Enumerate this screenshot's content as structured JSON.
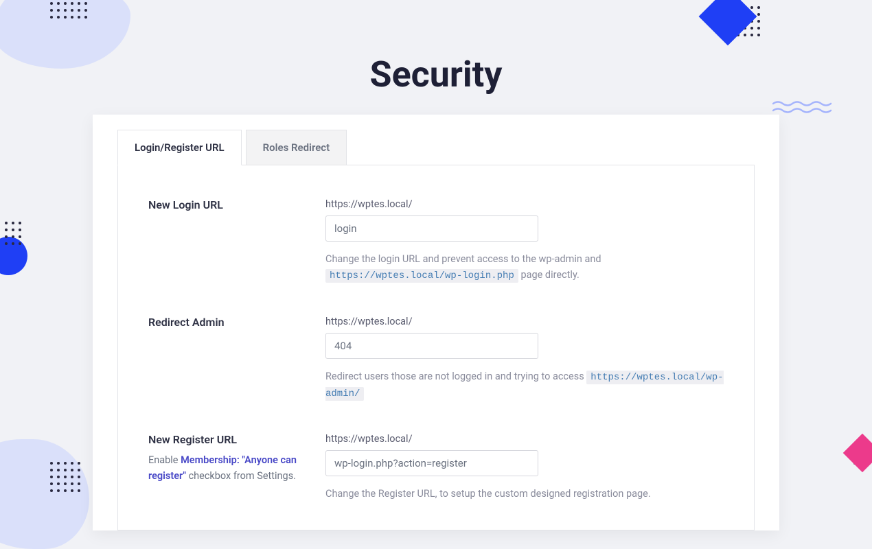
{
  "title": "Security",
  "tabs": [
    {
      "label": "Login/Register URL",
      "active": true
    },
    {
      "label": "Roles Redirect",
      "active": false
    }
  ],
  "fields": {
    "new_login_url": {
      "label": "New Login URL",
      "prefix": "https://wptes.local/",
      "value": "login",
      "helper_before": "Change the login URL and prevent access to the wp-admin and ",
      "helper_code": "https://wptes.local/wp-login.php",
      "helper_after": " page directly."
    },
    "redirect_admin": {
      "label": "Redirect Admin",
      "prefix": "https://wptes.local/",
      "value": "404",
      "helper_before": "Redirect users those are not logged in and trying to access ",
      "helper_code": "https://wptes.local/wp-admin/",
      "helper_after": ""
    },
    "new_register_url": {
      "label": "New Register URL",
      "sub_enable": "Enable ",
      "sub_link": "Membership: \"Anyone can register\"",
      "sub_after": " checkbox from Settings.",
      "prefix": "https://wptes.local/",
      "value": "wp-login.php?action=register",
      "helper": "Change the Register URL, to setup the custom designed registration page."
    }
  }
}
